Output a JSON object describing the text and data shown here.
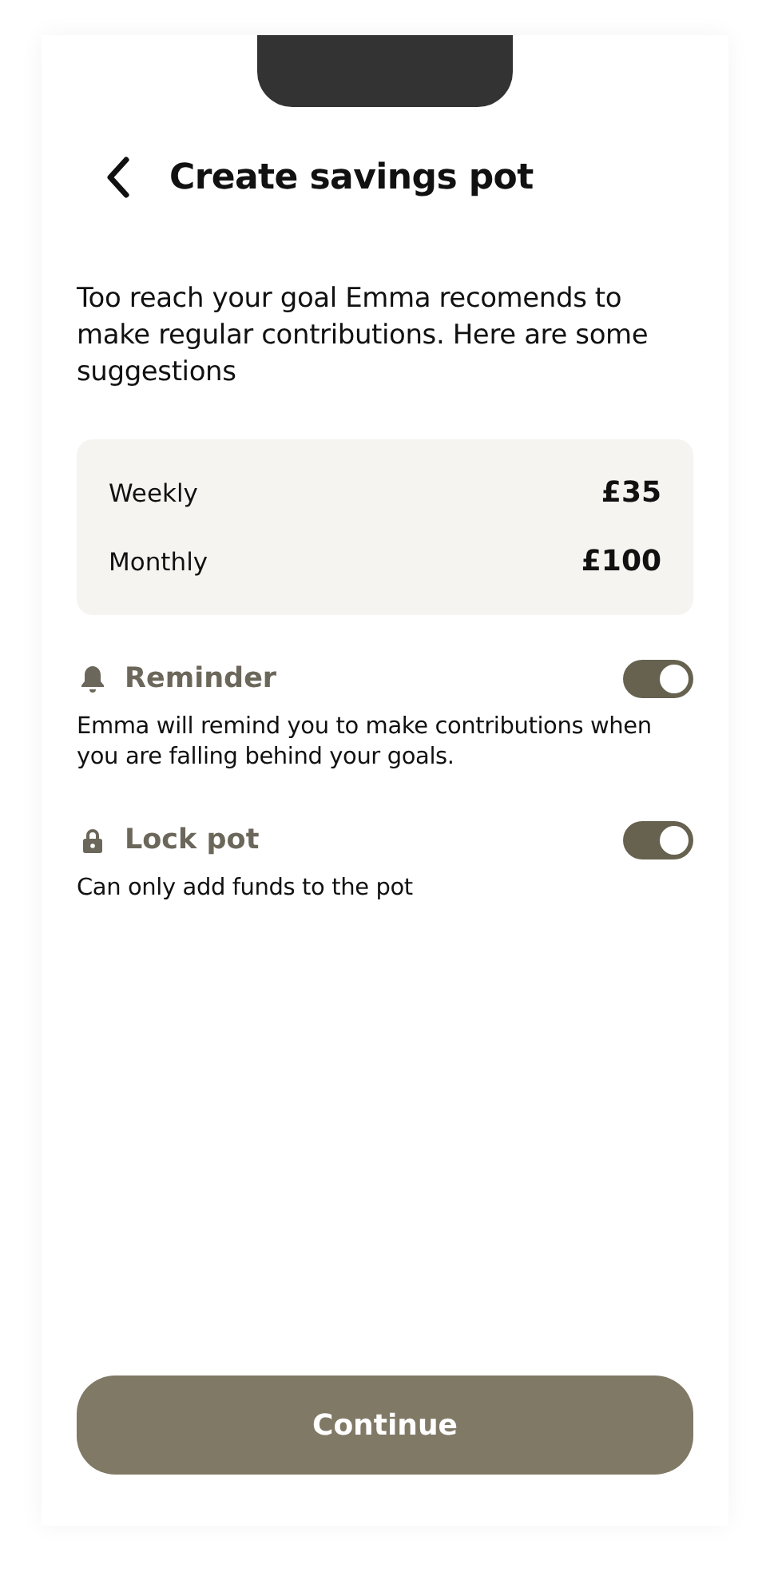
{
  "header": {
    "title": "Create savings pot"
  },
  "intro": "Too reach your goal Emma recomends to make regular contributions. Here are some suggestions",
  "suggestions": [
    {
      "label": "Weekly",
      "amount": "£35"
    },
    {
      "label": "Monthly",
      "amount": "£100"
    }
  ],
  "settings": [
    {
      "title": "Reminder",
      "description": "Emma will remind you to make contributions when you are falling behind your goals.",
      "on": true
    },
    {
      "title": "Lock pot",
      "description": "Can only add funds to the pot",
      "on": true
    }
  ],
  "primary_button": "Continue"
}
